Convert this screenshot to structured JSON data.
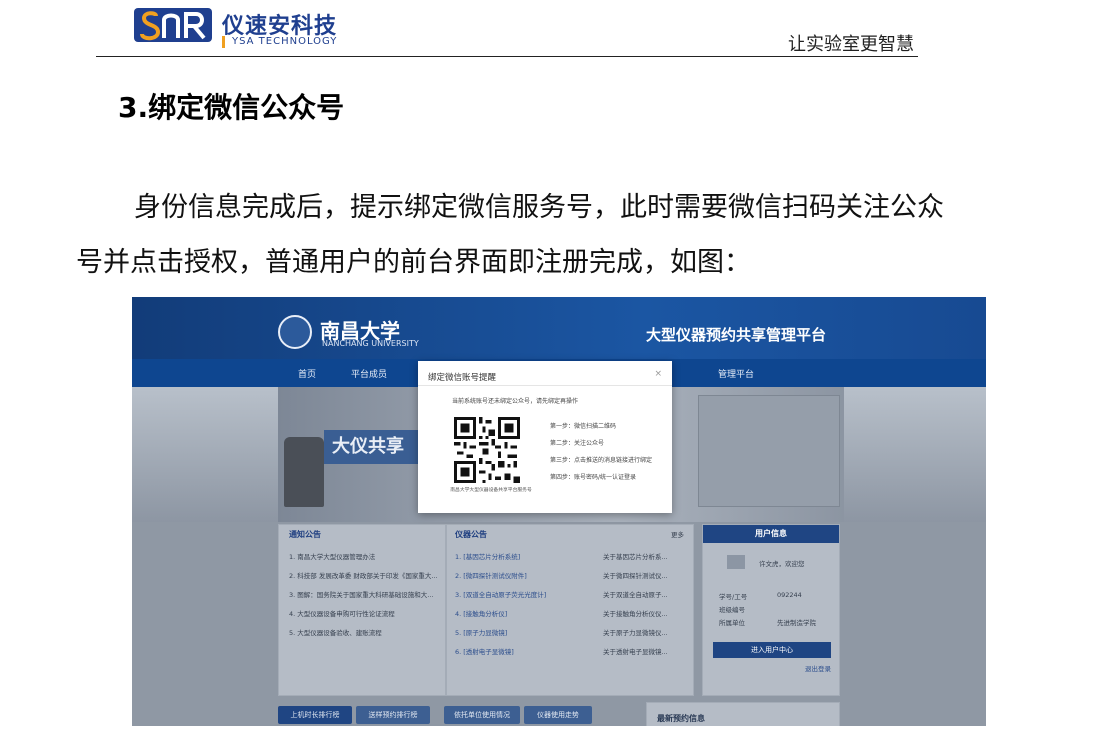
{
  "header": {
    "logo_cn": "仪速安科技",
    "logo_en": "YSA TECHNOLOGY",
    "slogan": "让实验室更智慧"
  },
  "section": {
    "title": "3.绑定微信公众号",
    "paragraph": "身份信息完成后，提示绑定微信服务号，此时需要微信扫码关注公众号并点击授权，普通用户的前台界面即注册完成，如图："
  },
  "screenshot": {
    "university_cn": "南昌大学",
    "university_en": "NANCHANG UNIVERSITY",
    "platform_title": "大型仪器预约共享管理平台",
    "nav": [
      "首页",
      "平台成员",
      "管理平台"
    ],
    "banner_text": "大仪共享",
    "modal": {
      "title": "绑定微信账号提醒",
      "close": "×",
      "tip": "当前系统账号还未绑定公众号，请先绑定再操作",
      "qr_caption": "南昌大学大型仪器设备共享平台服务号",
      "steps": [
        "第一步：微信扫描二维码",
        "第二步：关注公众号",
        "第三步：点击推送的消息链接进行绑定",
        "第四步：账号密码/统一认证登录"
      ]
    },
    "notice": {
      "title": "通知公告",
      "items": [
        "1. 南昌大学大型仪器管理办法",
        "2. 科技部 发展改革委 财政部关于印发《国家重大...",
        "3. 图解：国务院关于国家重大科研基础设施和大...",
        "4. 大型仪器设备申购可行性论证流程",
        "5. 大型仪器设备验收、建账流程"
      ]
    },
    "instruments": {
      "title": "仪器公告",
      "more": "更多",
      "items": [
        "1. [基因芯片分析系统]",
        "2. [微四探针测试仪附件]",
        "3. [双道全自动原子荧光光度计]",
        "4. [接触角分析仪]",
        "5. [原子力显微镜]",
        "6. [透射电子显微镜]"
      ],
      "descs": [
        "关于基因芯片分析系...",
        "关于微四探针测试仪...",
        "关于双道全自动原子...",
        "关于接触角分析仪仪...",
        "关于原子力显微镜仪...",
        "关于透射电子显微镜..."
      ]
    },
    "user": {
      "title": "用户信息",
      "greeting": "许文虎，欢迎您",
      "fields": [
        {
          "label": "学号/工号",
          "value": "092244"
        },
        {
          "label": "班级编号",
          "value": ""
        },
        {
          "label": "所属单位",
          "value": "先进制造学院"
        }
      ],
      "enter_button": "进入用户中心",
      "logout": "退出登录"
    },
    "tabs": [
      "上机时长排行榜",
      "送样预约排行榜",
      "依托单位使用情况",
      "仪器使用走势"
    ],
    "latest": "最新预约信息"
  }
}
